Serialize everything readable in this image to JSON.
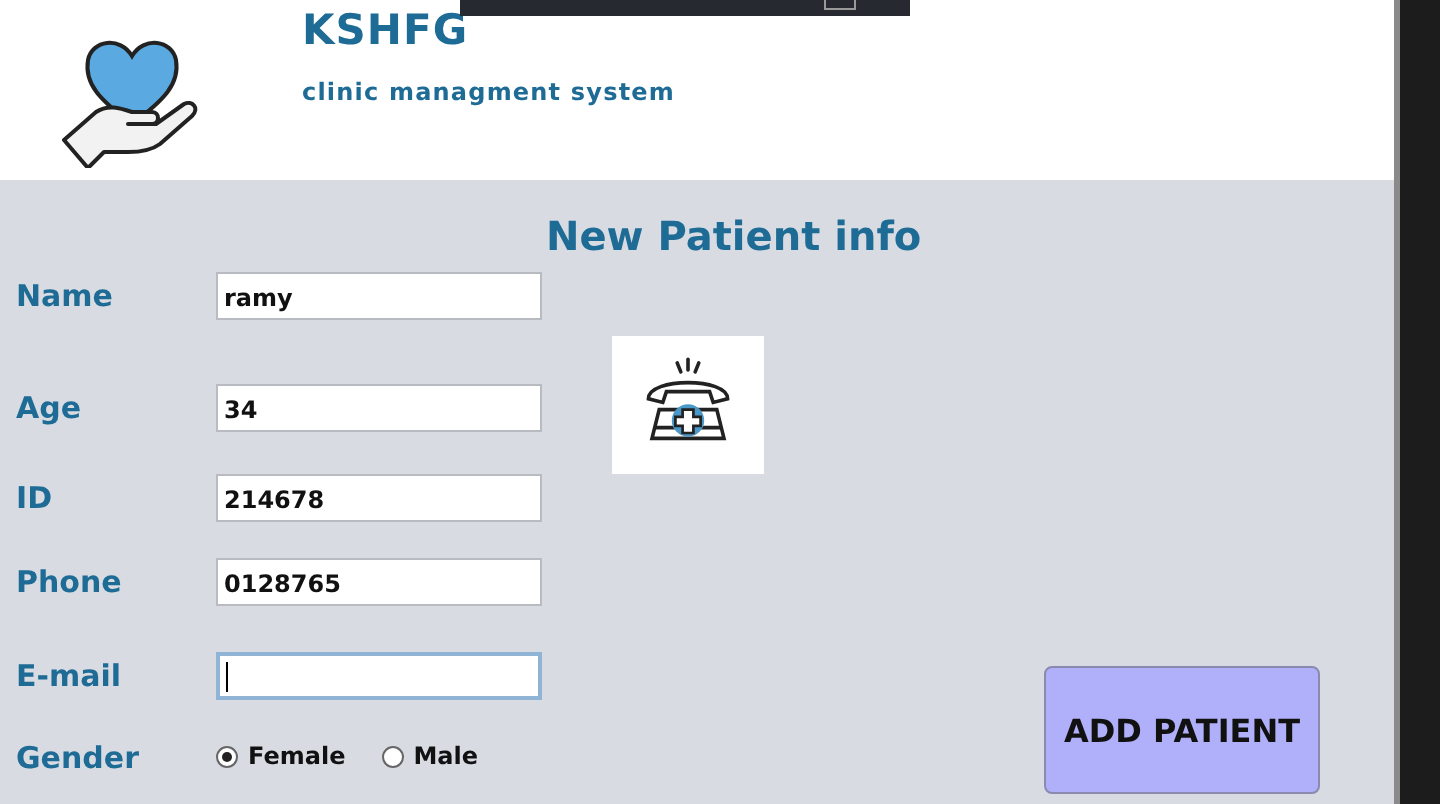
{
  "header": {
    "title": "KSHFG",
    "subtitle": "clinic managment system"
  },
  "form": {
    "title": "New Patient info",
    "fields": [
      {
        "label": "Name",
        "value": "ramy",
        "focused": false
      },
      {
        "label": "Age",
        "value": "34",
        "focused": false
      },
      {
        "label": "ID",
        "value": "214678",
        "focused": false
      },
      {
        "label": "Phone",
        "value": "0128765",
        "focused": false
      },
      {
        "label": "E-mail",
        "focused": true
      }
    ],
    "gender": {
      "label": "Gender",
      "options": [
        {
          "label": "Female",
          "selected": true
        },
        {
          "label": "Male",
          "selected": false
        }
      ]
    },
    "submit_button": "ADD PATIENT"
  }
}
